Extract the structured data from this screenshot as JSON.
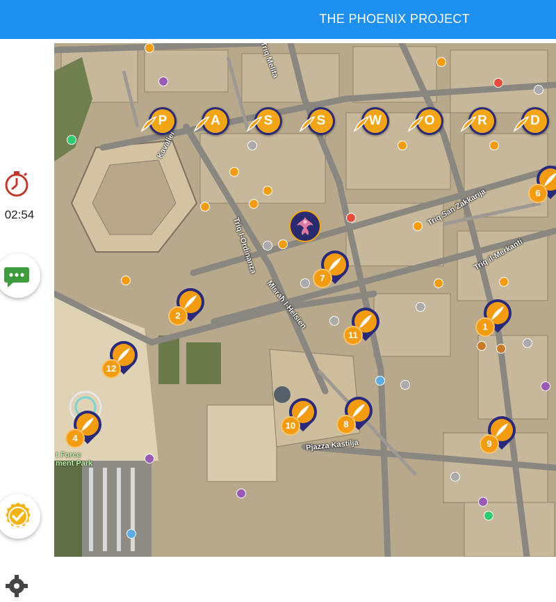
{
  "header": {
    "title": "THE PHOENIX PROJECT"
  },
  "sidebar": {
    "timer_icon": "stopwatch-icon",
    "timer": "02:54",
    "chat_icon": "chat-icon",
    "check_icon": "check-icon",
    "settings_icon": "gear-icon"
  },
  "map": {
    "password_letters": [
      "P",
      "A",
      "S",
      "S",
      "W",
      "O",
      "R",
      "D"
    ],
    "markers": [
      "1",
      "2",
      "4",
      "6",
      "7",
      "8",
      "9",
      "10",
      "11",
      "12"
    ],
    "streets": [
      "Triq Melita",
      "Kavalier",
      "Triq l-Ordinanza",
      "Misraħ l-Helsien",
      "Triq San Żakkarija",
      "Triq il-Merkanti",
      "Pjazza Kastilja"
    ],
    "park_label_lines": [
      "t Force",
      "ment Park"
    ],
    "colors": {
      "header": "#1E90F0",
      "marker_orange": "#F39C12",
      "marker_navy": "#2A2A7A",
      "timer_red": "#C0392B",
      "chat_green": "#3E9B3E",
      "check_gold": "#F2B415"
    }
  }
}
